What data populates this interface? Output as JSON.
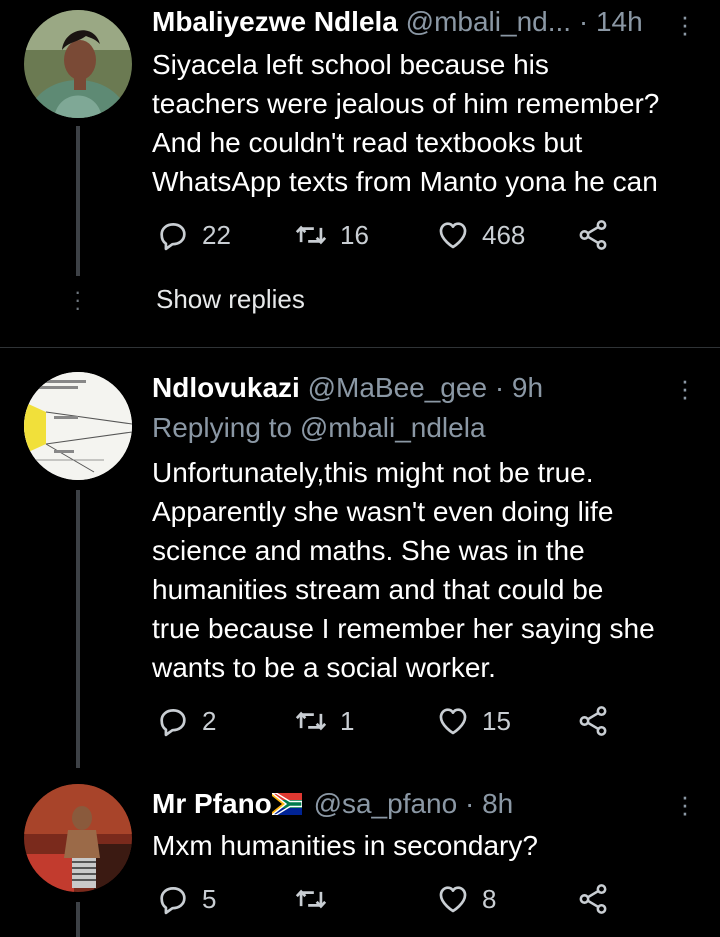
{
  "tweets": [
    {
      "name": "Mbaliyezwe Ndlela",
      "handle": "@mbali_nd...",
      "dot": "·",
      "time": "14h",
      "replying_prefix": "",
      "replying_handle": "",
      "text_lines": [
        "Siyacela left school because his",
        "teachers were jealous of him remember?",
        "And he couldn't read textbooks but",
        "WhatsApp texts from Manto yona he can"
      ],
      "replies": "22",
      "retweets": "16",
      "likes": "468",
      "show_replies": "Show replies"
    },
    {
      "name": "Ndlovukazi",
      "handle": "@MaBee_gee",
      "dot": "·",
      "time": "9h",
      "replying_prefix": "Replying to",
      "replying_handle": "@mbali_ndlela",
      "text_lines": [
        "Unfortunately,this might not be true.",
        "Apparently she wasn't even doing life",
        "science and maths. She was in the",
        "humanities stream and that could be",
        "true because I remember her saying she",
        "wants to be a social worker."
      ],
      "replies": "2",
      "retweets": "1",
      "likes": "15"
    },
    {
      "name": "Mr Pfano",
      "handle": "@sa_pfano",
      "dot": "·",
      "time": "8h",
      "text_lines": [
        "Mxm humanities in secondary?"
      ],
      "replies": "5",
      "retweets": "",
      "likes": "8"
    }
  ],
  "colors": {
    "background": "#000000",
    "text": "#ffffff",
    "muted": "#8b98a5",
    "divider": "#2f3336",
    "thread_line": "#3d4146"
  },
  "icons": {
    "reply": "speech-bubble-icon",
    "retweet": "retweet-icon",
    "like": "heart-icon",
    "share": "share-nodes-icon",
    "more": "more-vertical-icon",
    "flag": "south-africa-flag-icon"
  }
}
